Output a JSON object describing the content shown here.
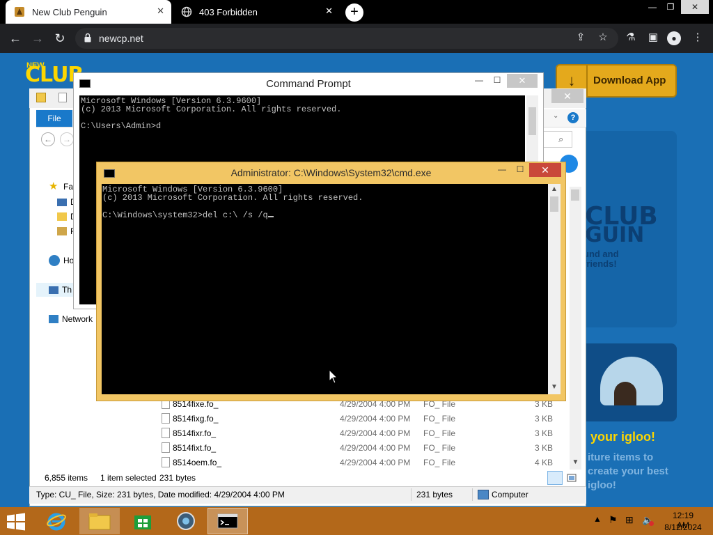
{
  "browser": {
    "tabs": [
      {
        "title": "New Club Penguin",
        "active": true
      },
      {
        "title": "403 Forbidden",
        "active": false
      }
    ],
    "url": "newcp.net",
    "window_controls": {
      "minimize": "—",
      "restore": "❐",
      "close": "✕"
    }
  },
  "webpage": {
    "logo_new": "NEW",
    "logo_text": "CLUB",
    "download_label": "Download App",
    "promo1_club": "CLUB",
    "promo1_guin": "GUIN",
    "promo1_line1": "und and",
    "promo1_line2": "friends!",
    "promo2_title": "your igloo!",
    "promo2_line1": "iture items to",
    "promo2_line2": "create your best",
    "promo2_line3": "igloo!"
  },
  "explorer": {
    "file_tab": "File",
    "help": "?",
    "nav": {
      "favorites": "Fav",
      "item_d1": "D",
      "item_d2": "D",
      "item_r": "R",
      "homegroup": "Ho",
      "this_pc": "Th",
      "network": "Network"
    },
    "files": [
      {
        "name": "8514fixe.fo_",
        "date": "4/29/2004 4:00 PM",
        "type": "FO_ File",
        "size": "3 KB"
      },
      {
        "name": "8514fixg.fo_",
        "date": "4/29/2004 4:00 PM",
        "type": "FO_ File",
        "size": "3 KB"
      },
      {
        "name": "8514fixr.fo_",
        "date": "4/29/2004 4:00 PM",
        "type": "FO_ File",
        "size": "3 KB"
      },
      {
        "name": "8514fixt.fo_",
        "date": "4/29/2004 4:00 PM",
        "type": "FO_ File",
        "size": "3 KB"
      },
      {
        "name": "8514oem.fo_",
        "date": "4/29/2004 4:00 PM",
        "type": "FO_ File",
        "size": "4 KB"
      }
    ],
    "status": {
      "items": "6,855 items",
      "selected": "1 item selected",
      "size": "231 bytes"
    },
    "details": {
      "type_info": "Type: CU_ File, Size: 231 bytes, Date modified: 4/29/2004 4:00 PM",
      "size": "231 bytes",
      "location": "Computer"
    }
  },
  "cmd_back": {
    "title": "Command Prompt",
    "lines": "Microsoft Windows [Version 6.3.9600]\n(c) 2013 Microsoft Corporation. All rights reserved.\n\nC:\\Users\\Admin>d"
  },
  "cmd_front": {
    "title": "Administrator: C:\\Windows\\System32\\cmd.exe",
    "lines": "Microsoft Windows [Version 6.3.9600]\n(c) 2013 Microsoft Corporation. All rights reserved.\n\nC:\\Windows\\system32>del c:\\ /s /q"
  },
  "taskbar": {
    "time": "12:19 AM",
    "date": "8/12/2024"
  },
  "colors": {
    "taskbar": "#b3681a",
    "admin_frame": "#f2c664",
    "close_red": "#c9483a",
    "page_blue": "#1a6fb5"
  }
}
